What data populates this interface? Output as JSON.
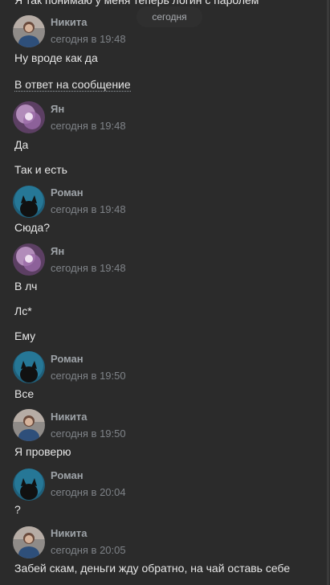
{
  "colors": {
    "background": "#2b2b2b",
    "author": "#9ea3a8",
    "time": "#7f8388",
    "text": "#e6e6e6",
    "pill": "#2f2f2f"
  },
  "header": {
    "cut_text": "Я так понимаю у меня теперь логин с паролем",
    "date_label": "сегодня"
  },
  "reply_label": "В ответ на сообщение",
  "messages": [
    {
      "author": "Никита",
      "time": "сегодня в 19:48",
      "avatar": "person-avatar",
      "lines": [
        "Ну вроде как да"
      ]
    },
    {
      "author": "Ян",
      "time": "сегодня в 19:48",
      "avatar": "purple-avatar",
      "lines": [
        "Да",
        "Так и есть"
      ]
    },
    {
      "author": "Роман",
      "time": "сегодня в 19:48",
      "avatar": "cat-avatar",
      "lines": [
        "Сюда?"
      ]
    },
    {
      "author": "Ян",
      "time": "сегодня в 19:48",
      "avatar": "purple-avatar",
      "lines": [
        "В лч",
        "Лс*",
        "Ему"
      ]
    },
    {
      "author": "Роман",
      "time": "сегодня в 19:50",
      "avatar": "cat-avatar",
      "lines": [
        "Все"
      ]
    },
    {
      "author": "Никита",
      "time": "сегодня в 19:50",
      "avatar": "person-avatar",
      "lines": [
        "Я проверю"
      ]
    },
    {
      "author": "Роман",
      "time": "сегодня в 20:04",
      "avatar": "cat-avatar",
      "lines": [
        "?"
      ]
    },
    {
      "author": "Никита",
      "time": "сегодня в 20:05",
      "avatar": "person-avatar",
      "lines": [
        "Забей скам, деньги жду обратно, на чай оставь себе"
      ]
    }
  ]
}
